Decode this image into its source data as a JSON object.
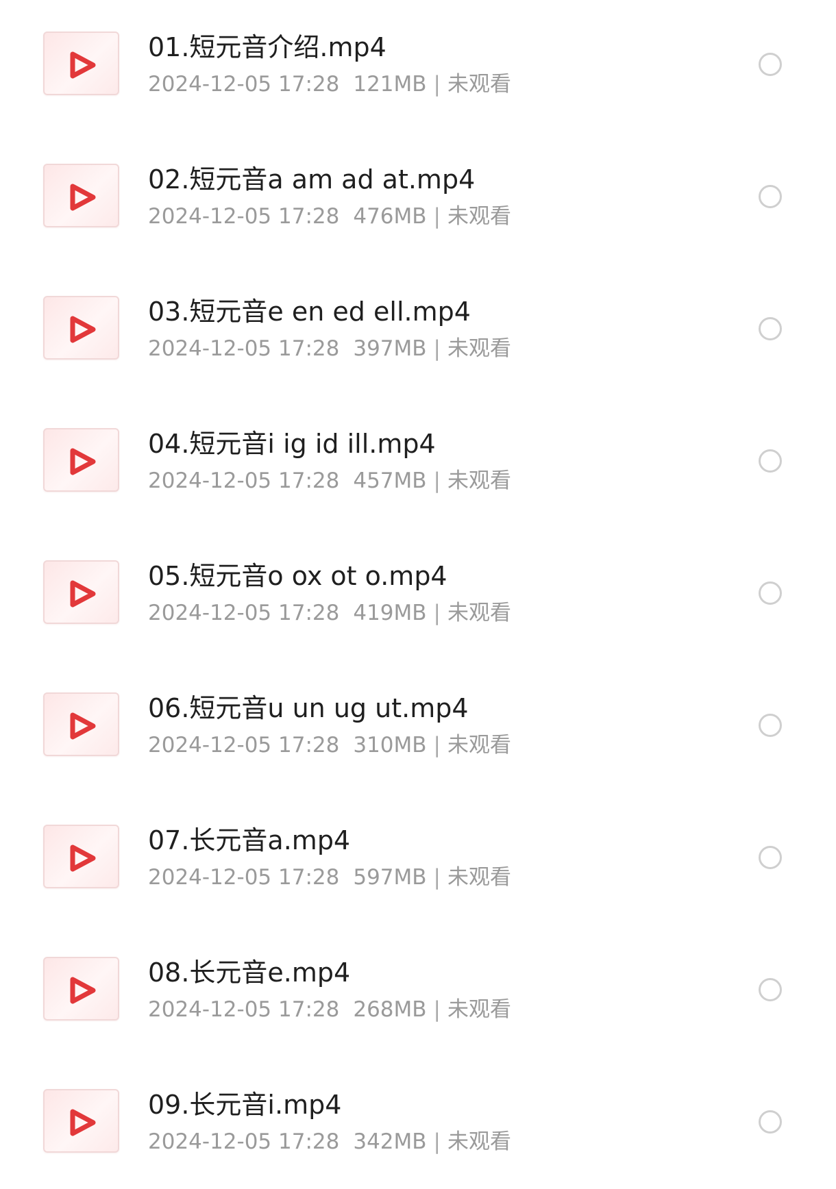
{
  "files": [
    {
      "name": "01.短元音介绍.mp4",
      "date": "2024-12-05 17:28",
      "size": "121MB",
      "status": "未观看"
    },
    {
      "name": "02.短元音a am ad at.mp4",
      "date": "2024-12-05 17:28",
      "size": "476MB",
      "status": "未观看"
    },
    {
      "name": "03.短元音e en ed ell.mp4",
      "date": "2024-12-05 17:28",
      "size": "397MB",
      "status": "未观看"
    },
    {
      "name": "04.短元音i ig id ill.mp4",
      "date": "2024-12-05 17:28",
      "size": "457MB",
      "status": "未观看"
    },
    {
      "name": "05.短元音o ox ot o.mp4",
      "date": "2024-12-05 17:28",
      "size": "419MB",
      "status": "未观看"
    },
    {
      "name": "06.短元音u un ug ut.mp4",
      "date": "2024-12-05 17:28",
      "size": "310MB",
      "status": "未观看"
    },
    {
      "name": "07.长元音a.mp4",
      "date": "2024-12-05 17:28",
      "size": "597MB",
      "status": "未观看"
    },
    {
      "name": "08.长元音e.mp4",
      "date": "2024-12-05 17:28",
      "size": "268MB",
      "status": "未观看"
    },
    {
      "name": "09.长元音i.mp4",
      "date": "2024-12-05 17:28",
      "size": "342MB",
      "status": "未观看"
    }
  ],
  "meta_separator": "|",
  "icons": {
    "thumbnail": "video-play-icon",
    "selector": "radio-unchecked-icon"
  },
  "colors": {
    "play_icon": "#e2383a",
    "thumbnail_bg": "#fde9e9",
    "meta_text": "#9a9a9a",
    "radio_border": "#cfcfcf"
  }
}
